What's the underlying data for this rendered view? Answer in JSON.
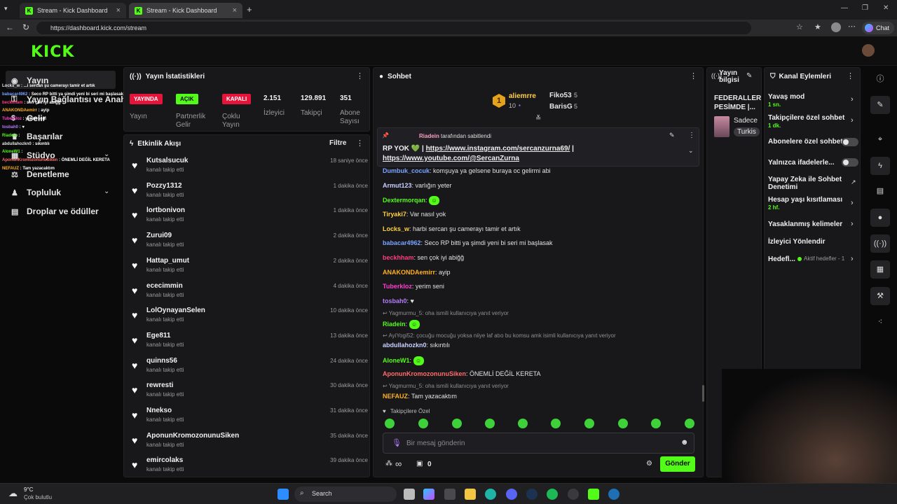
{
  "browser": {
    "tabs": [
      {
        "title": "Stream - Kick Dashboard"
      },
      {
        "title": "Stream - Kick Dashboard"
      }
    ],
    "url": "https://dashboard.kick.com/stream",
    "chat_button": "Chat"
  },
  "logo": "KICK",
  "sidebar": {
    "items": [
      {
        "label": "Yayın"
      },
      {
        "label": "Yayın Bağlantısı ve Anahtarı"
      },
      {
        "label": "Gelir"
      },
      {
        "label": "Başarılar"
      },
      {
        "label": "Stüdyo"
      },
      {
        "label": "Denetleme"
      },
      {
        "label": "Topluluk"
      },
      {
        "label": "Droplar ve ödüller"
      }
    ]
  },
  "overlay_chat": [
    {
      "user": "Locks_w",
      "text": "...i sercan şu camerayı tamir et artık",
      "color": "#e6e6e6"
    },
    {
      "user": "babacar4962",
      "text": "Seco RP bitti ya şimdi yeni bi seri mi başlasak",
      "color": "#7aa2ff"
    },
    {
      "user": "beckhham",
      "text": "sen çok iyi abiğğ",
      "color": "#ff3d7f"
    },
    {
      "user": "ANAKONDAemirr",
      "text": "ayip",
      "color": "#ffb020"
    },
    {
      "user": "Tuberkloz",
      "text": "yerim seni",
      "color": "#ff3dd0"
    },
    {
      "user": "tosbah0",
      "text": "♥",
      "color": "#b57bff"
    },
    {
      "user": "Riadein",
      "text": "",
      "color": "#53fc18"
    },
    {
      "user": "abdullahozkn0",
      "text": "sıkıntılı",
      "color": "#e6e6e6"
    },
    {
      "user": "AloneW1",
      "text": "",
      "color": "#53fc18"
    },
    {
      "user": "AponunKromozonunuSiken",
      "text": "ÖNEMLİ DEĞİL KERETA",
      "color": "#ff6b6b"
    },
    {
      "user": "NEFAUZ",
      "text": "Tam yazacaktım",
      "color": "#ffb020"
    }
  ],
  "stats": {
    "title": "Yayın İstatistikleri",
    "badges": [
      {
        "label": "YAYINDA",
        "color": "#e5143a"
      },
      {
        "label": "AÇIK",
        "color": "#53fc18"
      },
      {
        "label": "KAPALI",
        "color": "#e5143a"
      }
    ],
    "badge_captions": [
      "Yayın",
      "Partnerlik Gelir",
      "Çoklu Yayın"
    ],
    "numbers": [
      {
        "value": "2.151",
        "label": "İzleyici"
      },
      {
        "value": "129.891",
        "label": "Takipçi"
      },
      {
        "value": "351",
        "label": "Abone Sayısı"
      }
    ]
  },
  "activity": {
    "title": "Etkinlik Akışı",
    "filter": "Filtre",
    "rows": [
      {
        "name": "Kutsalsucuk",
        "action": "kanalı takip etti",
        "time": "18 saniye önce"
      },
      {
        "name": "Pozzy1312",
        "action": "kanalı takip etti",
        "time": "1 dakika önce"
      },
      {
        "name": "lortbonivon",
        "action": "kanalı takip etti",
        "time": "1 dakika önce"
      },
      {
        "name": "Zurui09",
        "action": "kanalı takip etti",
        "time": "2 dakika önce"
      },
      {
        "name": "Hattap_umut",
        "action": "kanalı takip etti",
        "time": "2 dakika önce"
      },
      {
        "name": "ececimmin",
        "action": "kanalı takip etti",
        "time": "4 dakika önce"
      },
      {
        "name": "LolOynayanSelen",
        "action": "kanalı takip etti",
        "time": "10 dakika önce"
      },
      {
        "name": "Ege811",
        "action": "kanalı takip etti",
        "time": "13 dakika önce"
      },
      {
        "name": "quinns56",
        "action": "kanalı takip etti",
        "time": "24 dakika önce"
      },
      {
        "name": "rewresti",
        "action": "kanalı takip etti",
        "time": "30 dakika önce"
      },
      {
        "name": "Nnekso",
        "action": "kanalı takip etti",
        "time": "31 dakika önce"
      },
      {
        "name": "AponunKromozonunuSiken",
        "action": "kanalı takip etti",
        "time": "35 dakika önce"
      },
      {
        "name": "emircolaks",
        "action": "kanalı takip etti",
        "time": "39 dakika önce"
      }
    ]
  },
  "chat": {
    "title": "Sohbet",
    "leaderboard": {
      "first": {
        "name": "aliemrre",
        "rank": "1",
        "count": "10"
      },
      "others": [
        {
          "name": "Fiko53",
          "count": "5"
        },
        {
          "name": "BarisG",
          "count": "5"
        }
      ]
    },
    "pinned": {
      "by": "Riadein",
      "by_suffix": "tarafından sabitlendi",
      "text": "RP YOK 💚 |",
      "link1": "https://www.instagram.com/sercanzurna69/",
      "link1_suffix": "|",
      "link2": "https://www.youtube.com/@SercanZurna"
    },
    "messages": [
      {
        "user": "Dumbuk_cocuk",
        "text": "komşuya ya gelsene buraya oc gelirmi abi",
        "color": "#7aa2ff"
      },
      {
        "user": "Armut123",
        "text": "varlığın yeter",
        "color": "#c9d1ff"
      },
      {
        "user": "Dextermorqan",
        "text": "",
        "color": "#53fc18"
      },
      {
        "user": "Tiryaki7",
        "text": "Var nasıl yok",
        "color": "#ffd23d"
      },
      {
        "user": "Locks_w",
        "text": "harbi sercan şu camerayı tamir et artık",
        "color": "#ffd23d"
      },
      {
        "user": "babacar4962",
        "text": "Seco RP bitti ya şimdi yeni bi seri mi başlasak",
        "color": "#7aa2ff"
      },
      {
        "user": "beckhham",
        "text": "sen çok iyi abiğğ",
        "color": "#ff3d7f"
      },
      {
        "user": "ANAKONDAemirr",
        "text": "ayip",
        "color": "#ffb020"
      },
      {
        "user": "Tuberkloz",
        "text": "yerim seni",
        "color": "#ff3dd0"
      },
      {
        "user": "tosbah0",
        "text": "♥",
        "color": "#b57bff"
      },
      {
        "reply": "Yagmurmu_5: oha ismili kullanıcıya yanıt veriyor"
      },
      {
        "user": "Riadein",
        "text": "",
        "color": "#53fc18"
      },
      {
        "reply": "AyiYogi52: çocuğu mocuğu yoksa niiye laf atıo bu komsu amk isimli kullanıcıya yanıt veriyor"
      },
      {
        "user": "abdullahozkn0",
        "text": "sıkıntılı",
        "color": "#c9d1ff"
      },
      {
        "user": "AloneW1",
        "text": "",
        "color": "#53fc18"
      },
      {
        "user": "AponunKromozonunuSiken",
        "text": "ÖNEMLİ DEĞİL KERETA",
        "color": "#ff6b6b"
      },
      {
        "reply": "Yagmurmu_5: oha ismili kullanıcıya yanıt veriyor"
      },
      {
        "user": "NEFAUZ",
        "text": "Tam yazacaktım",
        "color": "#ffb020"
      }
    ],
    "emote_label": "Takipçilere Özel",
    "input_placeholder": "Bir mesaj gönderin",
    "points": "∞",
    "gifts": "0",
    "send": "Gönder"
  },
  "stream_info": {
    "title": "Yayın bilgisi",
    "headline": "FEDERALLER PESİMDE |...",
    "tag1": "Sadece",
    "tag2": "Turkis"
  },
  "channel_actions": {
    "title": "Kanal Eylemleri",
    "items": [
      {
        "label": "Yavaş mod",
        "sub": "1 sn."
      },
      {
        "label": "Takipçilere özel sohbet",
        "sub": "1 dk."
      },
      {
        "label": "Abonelere özel sohbet",
        "sub": ""
      },
      {
        "label": "Yalnızca ifadelerle...",
        "sub": ""
      },
      {
        "label": "Yapay Zeka ile Sohbet Denetimi",
        "sub": ""
      },
      {
        "label": "Hesap yaşı kısıtlaması",
        "sub": "2 hf."
      },
      {
        "label": "Yasaklanmış kelimeler",
        "sub": ""
      },
      {
        "label": "İzleyici Yönlendir",
        "sub": ""
      },
      {
        "label": "Hedefl...",
        "sub": ""
      }
    ],
    "goals_status": "Aktif hedefler - 1"
  },
  "taskbar": {
    "weather_temp": "9°C",
    "weather_desc": "Çok bulutlu",
    "search": "Search"
  }
}
